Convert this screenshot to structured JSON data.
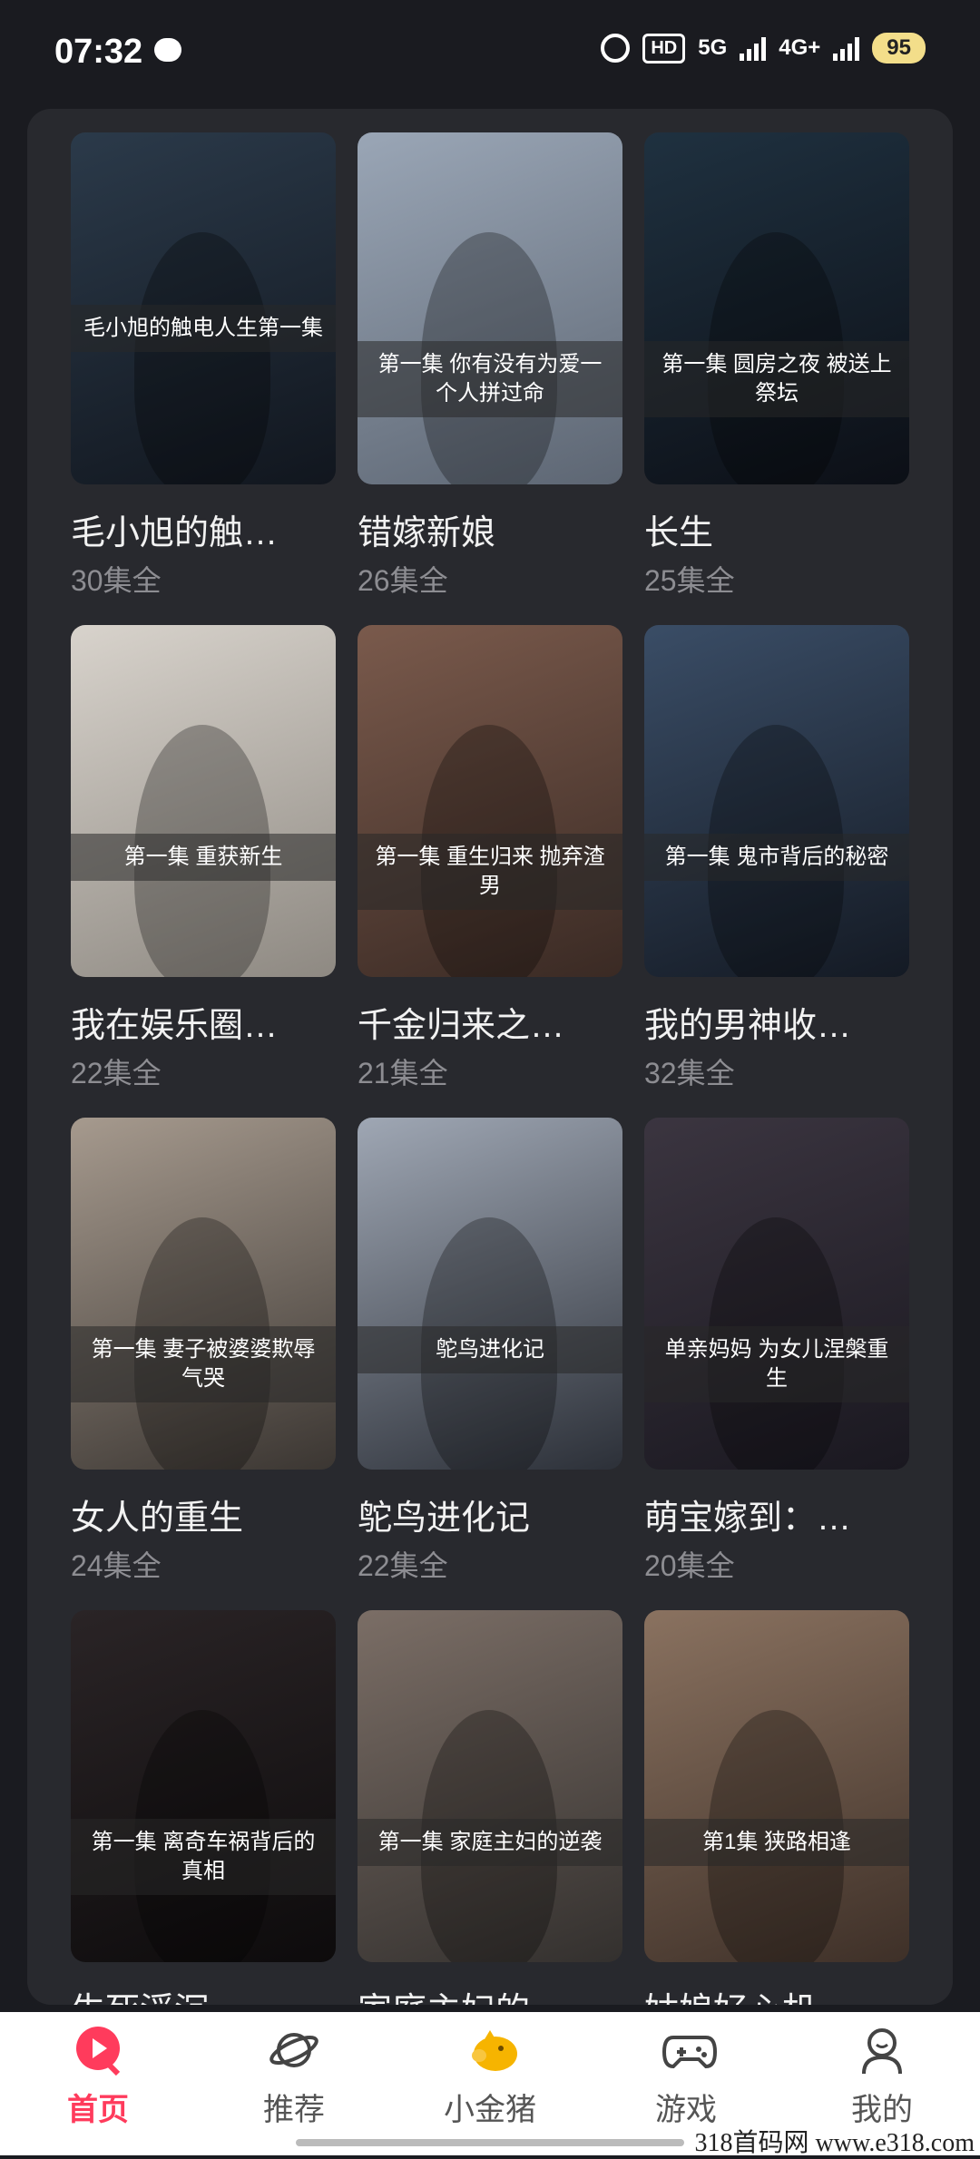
{
  "status_bar": {
    "time": "07:32",
    "hd_label": "HD",
    "net_5g": "5G",
    "net_4g": "4G+",
    "battery": "95"
  },
  "dramas": [
    {
      "title": "毛小旭的触…",
      "count": "30集全",
      "cover_text": "毛小旭的触电人生第一集",
      "colors": [
        "#2b3a4a",
        "#11161e"
      ]
    },
    {
      "title": "错嫁新娘",
      "count": "26集全",
      "cover_text": "第一集 你有没有为爱一个人拼过命",
      "colors": [
        "#9aa6b6",
        "#5d6673"
      ]
    },
    {
      "title": "长生",
      "count": "25集全",
      "cover_text": "第一集 圆房之夜 被送上祭坛",
      "colors": [
        "#1f3140",
        "#0c0f16"
      ]
    },
    {
      "title": "我在娱乐圈…",
      "count": "22集全",
      "cover_text": "第一集 重获新生",
      "colors": [
        "#d8d3cc",
        "#8e8982"
      ]
    },
    {
      "title": "千金归来之…",
      "count": "21集全",
      "cover_text": "第一集 重生归来 抛弃渣男",
      "colors": [
        "#7a5a4c",
        "#3a2a24"
      ]
    },
    {
      "title": "我的男神收…",
      "count": "32集全",
      "cover_text": "第一集 鬼市背后的秘密",
      "colors": [
        "#3a4d66",
        "#141a24"
      ]
    },
    {
      "title": "女人的重生",
      "count": "24集全",
      "cover_text": "第一集 妻子被婆婆欺辱气哭",
      "colors": [
        "#a69a8e",
        "#3b3632"
      ]
    },
    {
      "title": "鸵鸟进化记",
      "count": "22集全",
      "cover_text": "鸵鸟进化记",
      "colors": [
        "#9fa7b4",
        "#2c3038"
      ]
    },
    {
      "title": "萌宝嫁到：…",
      "count": "20集全",
      "cover_text": "单亲妈妈 为女儿涅槃重生",
      "colors": [
        "#3b3540",
        "#1a1820"
      ]
    },
    {
      "title": "生死浮沉",
      "count": "",
      "cover_text": "第一集 离奇车祸背后的真相",
      "colors": [
        "#2a2426",
        "#0d0b0c"
      ]
    },
    {
      "title": "家庭主妇的…",
      "count": "",
      "cover_text": "第一集 家庭主妇的逆袭",
      "colors": [
        "#7b6e66",
        "#33302e"
      ]
    },
    {
      "title": "姑娘好心机",
      "count": "",
      "cover_text": "第1集 狭路相逢",
      "colors": [
        "#8a7260",
        "#3e3028"
      ]
    }
  ],
  "bottom_nav": [
    {
      "label": "首页",
      "icon": "play-circle-icon",
      "active": true
    },
    {
      "label": "推荐",
      "icon": "planet-icon",
      "active": false
    },
    {
      "label": "小金猪",
      "icon": "golden-pig-icon",
      "active": false
    },
    {
      "label": "游戏",
      "icon": "gamepad-icon",
      "active": false
    },
    {
      "label": "我的",
      "icon": "profile-icon",
      "active": false
    }
  ],
  "watermark": "318首码网 www.e318.com",
  "colors": {
    "accent": "#ff3b5c",
    "panel": "#28292e",
    "background": "#1a1b20"
  }
}
